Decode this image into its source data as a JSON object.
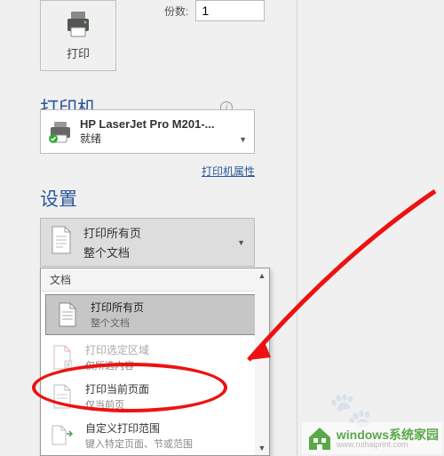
{
  "print_button": {
    "label": "打印"
  },
  "copies": {
    "label": "份数:",
    "value": "1"
  },
  "printer_section": {
    "header": "打印机"
  },
  "printer": {
    "name": "HP LaserJet Pro M201-...",
    "status": "就绪"
  },
  "printer_props_link": "打印机属性",
  "settings_section": {
    "header": "设置"
  },
  "page_scope": {
    "title": "打印所有页",
    "subtitle": "整个文档"
  },
  "dropdown": {
    "group_label": "文档",
    "items": [
      {
        "title": "打印所有页",
        "subtitle": "整个文档"
      },
      {
        "title": "打印选定区域",
        "subtitle": "仅所选内容"
      },
      {
        "title": "打印当前页面",
        "subtitle": "仅当前页"
      },
      {
        "title": "自定义打印范围",
        "subtitle": "键入特定页面、节或范围"
      }
    ]
  },
  "watermark": {
    "brand": "windows系统家园",
    "sub": "www.ruihaiprint.com"
  }
}
